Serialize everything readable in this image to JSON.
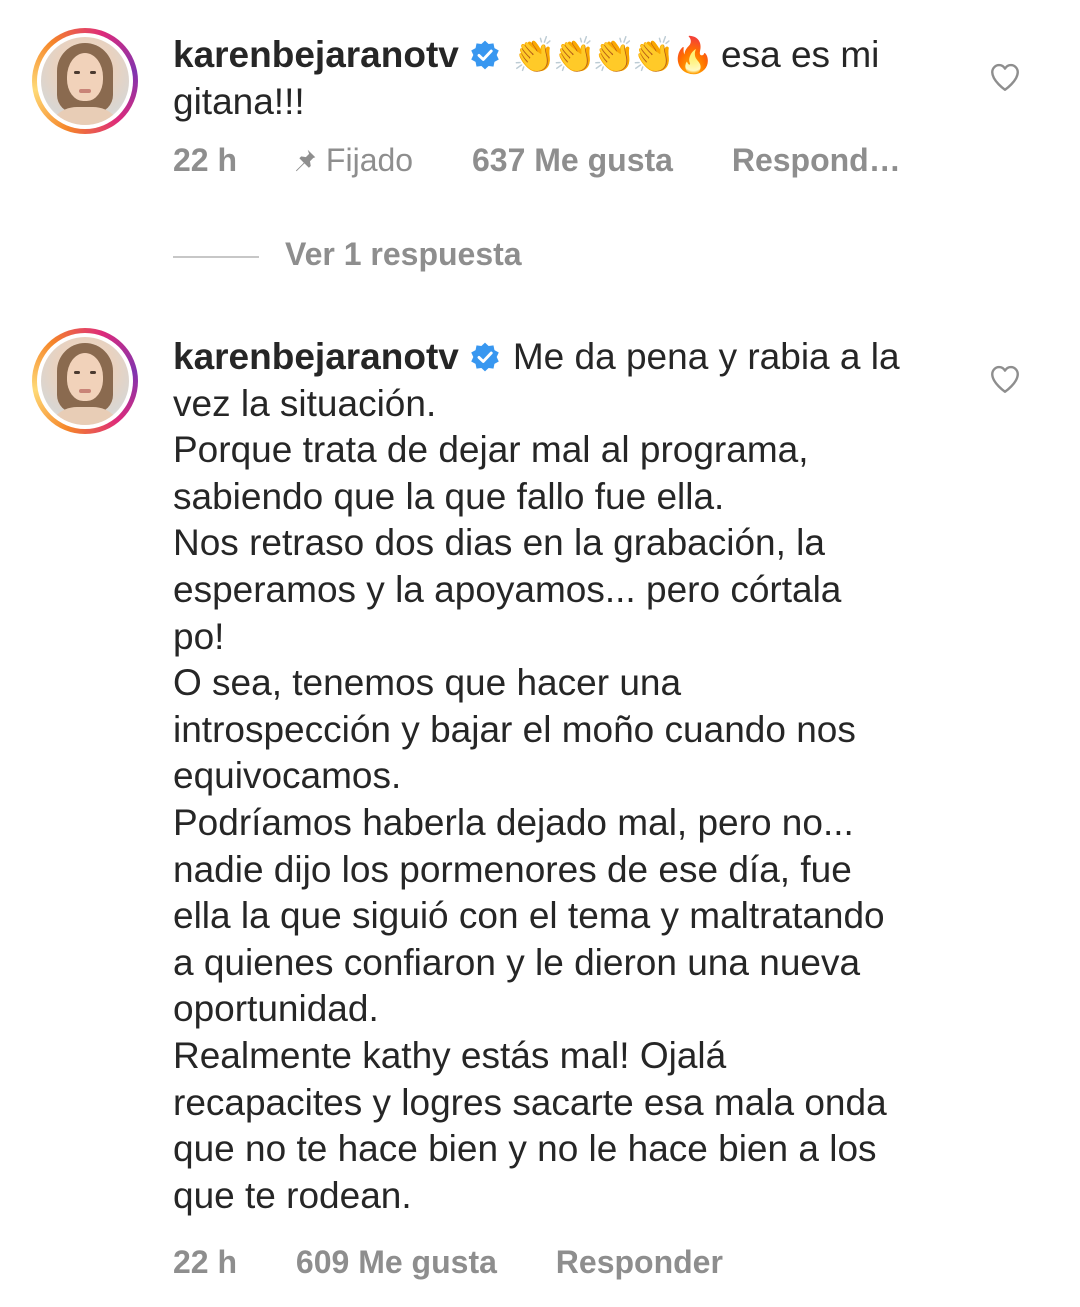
{
  "comments": [
    {
      "username": "karenbejaranotv",
      "verified": true,
      "emojis": "👏👏👏👏🔥",
      "text": "esa es mi\ngitana!!!",
      "time": "22 h",
      "pinned_label": "Fijado",
      "likes": "637 Me gusta",
      "reply_label": "Respond…",
      "view_replies_label": "Ver 1 respuesta"
    },
    {
      "username": "karenbejaranotv",
      "verified": true,
      "text": "Me da pena y rabia a la\nvez la situación.\nPorque trata de dejar mal al programa,\nsabiendo que la que fallo fue ella.\nNos retraso dos dias en la grabación, la\nesperamos y la apoyamos... pero córtala\npo!\nO sea, tenemos que hacer una\nintrospección y bajar el moño cuando nos\nequivocamos.\nPodríamos haberla dejado mal, pero no...\nnadie dijo los pormenores de ese día, fue\nella la que siguió con el tema y maltratando\na quienes confiaron y le dieron una nueva\noportunidad.\nRealmente kathy estás mal! Ojalá\nrecapacites y logres sacarte esa mala onda\nque no te hace bien y no le hace bien a los\nque te rodean.",
      "time": "22 h",
      "likes": "609 Me gusta",
      "reply_label": "Responder"
    }
  ],
  "icons": {
    "verified": "verified-badge-icon",
    "heart": "heart-outline-icon",
    "pin": "pin-icon"
  },
  "colors": {
    "text": "#262626",
    "meta": "#8e8e8e",
    "verified": "#3897f0"
  }
}
